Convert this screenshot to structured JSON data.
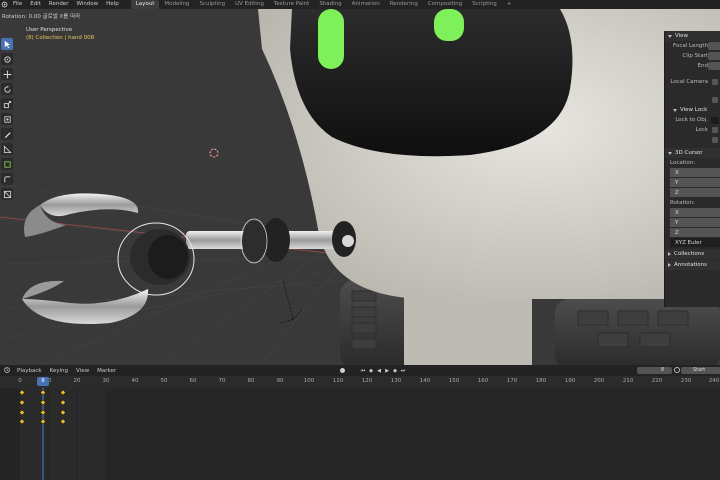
{
  "menu": [
    "File",
    "Edit",
    "Render",
    "Window",
    "Help"
  ],
  "workspaces": [
    {
      "label": "Layout",
      "active": true
    },
    {
      "label": "Modeling"
    },
    {
      "label": "Sculpting"
    },
    {
      "label": "UV Editing"
    },
    {
      "label": "Texture Paint"
    },
    {
      "label": "Shading"
    },
    {
      "label": "Animation"
    },
    {
      "label": "Rendering"
    },
    {
      "label": "Compositing"
    },
    {
      "label": "Scripting"
    }
  ],
  "add_tab": "+",
  "viewport": {
    "operator_status": "Rotation: 0.00 글로벌 X를 따라",
    "perspective": "User Perspective",
    "collection": "(8) Collection | hand 008"
  },
  "npanel": {
    "view_header": "View",
    "focal_length": "Focal Length",
    "clip_start": "Clip Start",
    "clip_end": "End",
    "local_camera": "Local Camera",
    "r_label": "R",
    "view_lock_header": "View Lock",
    "lock_to_object": "Lock to Obj.",
    "lock": "Lock",
    "lock_opt1": "T",
    "lock_opt2": "C",
    "cursor_header": "3D Cursor",
    "location": "Location:",
    "rotation": "Rotation:",
    "axes": [
      "X",
      "Y",
      "Z"
    ],
    "rot_mode": "XYZ Euler",
    "collections": "Collections",
    "annotations": "Annotations"
  },
  "timeline": {
    "menu": [
      "Playback",
      "Keying",
      "View",
      "Marker"
    ],
    "current_frame_field": "8",
    "start_label": "Start",
    "current_frame": "8",
    "ruler": [
      "0",
      "10",
      "20",
      "30",
      "40",
      "50",
      "60",
      "70",
      "80",
      "90",
      "100",
      "110",
      "120",
      "130",
      "140",
      "150",
      "160",
      "170",
      "180",
      "190",
      "200",
      "210",
      "220",
      "230",
      "240"
    ]
  },
  "colors": {
    "accent": "#4772b3",
    "eye_glow": "#7ef05a",
    "keyframe": "#e8b824",
    "collection_text": "#e7c85a"
  }
}
